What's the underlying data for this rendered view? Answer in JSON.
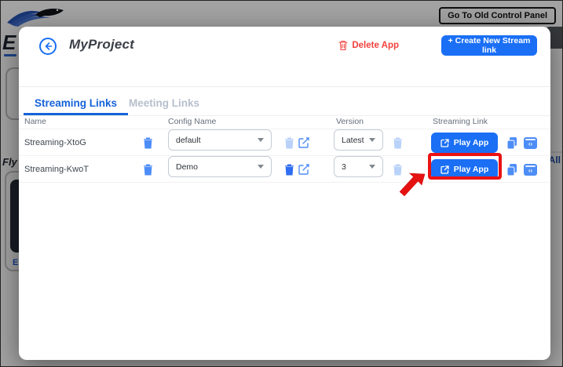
{
  "background": {
    "old_panel_button": "Go To Old Control Panel",
    "brand_word_partial": "E",
    "section_title_partial": "Fly",
    "card_label_partial": "E",
    "view_all_partial": "All"
  },
  "modal": {
    "title": "MyProject",
    "delete_app_label": "Delete App",
    "create_button_label": "+ Create New Stream link",
    "tabs": [
      {
        "label": "Streaming Links",
        "active": true
      },
      {
        "label": "Meeting Links",
        "active": false
      }
    ],
    "table": {
      "headers": [
        "Name",
        "Config Name",
        "Version",
        "Streaming Link"
      ],
      "rows": [
        {
          "name": "Streaming-XtoG",
          "config": "default",
          "version": "Latest",
          "play_label": "Play App",
          "highlighted": false
        },
        {
          "name": "Streaming-KwoT",
          "config": "Demo",
          "version": "3",
          "play_label": "Play App",
          "highlighted": true
        }
      ]
    }
  },
  "colors": {
    "accent_blue": "#1a6ff5",
    "icon_blue": "#4d8df7",
    "icon_blue_disabled": "#b9d2fa",
    "tab_active_blue": "#1563d8",
    "tab_inactive_gray": "#b7c0cc",
    "delete_red": "#f2413d",
    "annotation_red": "#ec1212",
    "header_text": "#66707c",
    "body_text": "#3f4650"
  }
}
